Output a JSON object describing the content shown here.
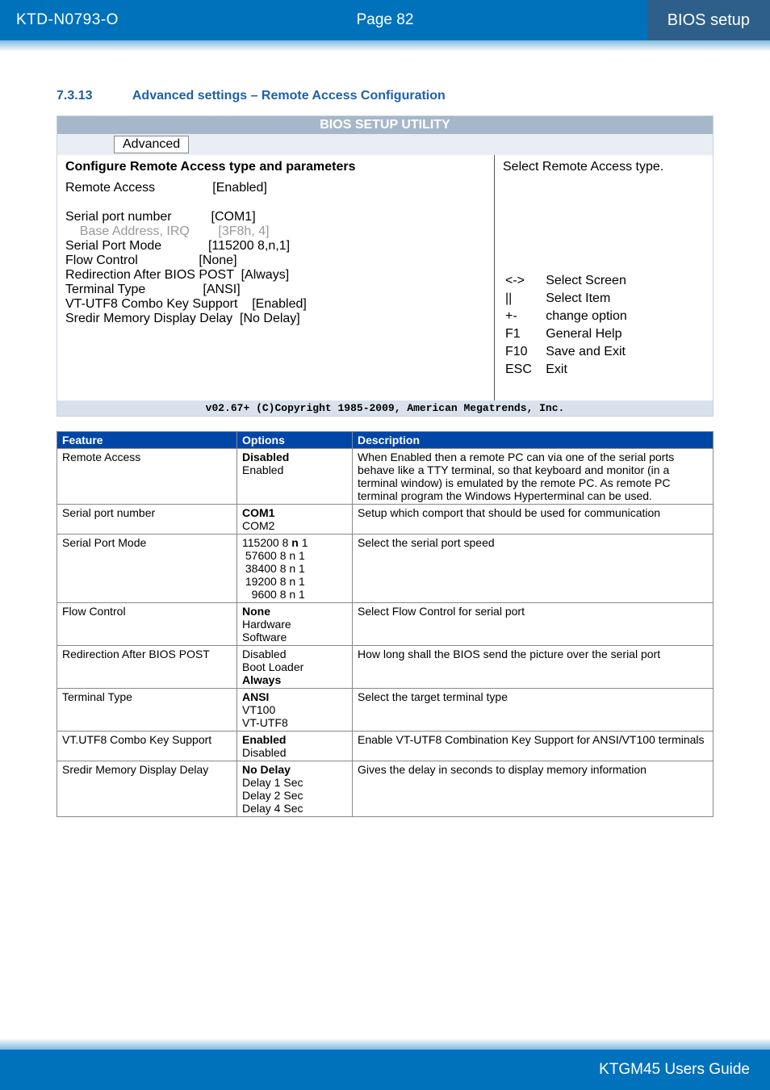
{
  "header": {
    "doc_id": "KTD-N0793-O",
    "page_label": "Page 82",
    "section": "BIOS setup"
  },
  "heading": {
    "number": "7.3.13",
    "title": "Advanced settings – Remote Access Configuration"
  },
  "bios": {
    "title": "BIOS SETUP UTILITY",
    "tab": "Advanced",
    "header_line": "Configure Remote Access type and parameters",
    "items": [
      {
        "label": "Remote Access",
        "value": "[Enabled]",
        "gray": false,
        "indent": 0
      },
      {
        "label": "",
        "value": "",
        "spacer": true
      },
      {
        "label": "Serial port number",
        "value": "[COM1]",
        "gray": false,
        "indent": 0
      },
      {
        "label": "Base Address, IRQ",
        "value": "[3F8h, 4]",
        "gray": true,
        "indent": 1
      },
      {
        "label": "Serial Port Mode",
        "value": "[115200 8,n,1]",
        "gray": false,
        "indent": 0
      },
      {
        "label": "Flow Control",
        "value": "[None]",
        "gray": false,
        "indent": 0
      },
      {
        "label": "Redirection After BIOS POST",
        "value": "[Always]",
        "gray": false,
        "indent": 0
      },
      {
        "label": "Terminal Type",
        "value": "[ANSI]",
        "gray": false,
        "indent": 0
      },
      {
        "label": "VT-UTF8 Combo Key Support",
        "value": "[Enabled]",
        "gray": false,
        "indent": 0
      },
      {
        "label": "Sredir Memory Display Delay",
        "value": "[No Delay]",
        "gray": false,
        "indent": 0
      }
    ],
    "help_top": "Select Remote Access type.",
    "help_keys": [
      {
        "k": "<->",
        "v": "Select Screen"
      },
      {
        "k": "||",
        "v": "Select Item"
      },
      {
        "k": "+-",
        "v": "change option"
      },
      {
        "k": "F1",
        "v": "General Help"
      },
      {
        "k": "F10",
        "v": "Save and Exit"
      },
      {
        "k": "ESC",
        "v": "Exit"
      }
    ],
    "copyright": "v02.67+ (C)Copyright 1985-2009, American Megatrends, Inc."
  },
  "table": {
    "headers": {
      "feature": "Feature",
      "options": "Options",
      "description": "Description"
    },
    "rows": [
      {
        "feature": "Remote Access",
        "options": [
          {
            "t": "Disabled",
            "b": true
          },
          {
            "t": "Enabled"
          }
        ],
        "description": "When Enabled then a remote PC can via one of the serial ports behave like a TTY terminal, so that keyboard and monitor (in a terminal window) is emulated by the remote PC. As remote PC terminal program the Windows Hyperterminal can be used."
      },
      {
        "feature": "Serial port number",
        "options": [
          {
            "t": "COM1",
            "b": true
          },
          {
            "t": "COM2"
          }
        ],
        "description": "Setup which comport that should be used for communication"
      },
      {
        "feature": "Serial Port Mode",
        "options_raw": [
          {
            "pre": "115200 8 ",
            "bold": "n",
            "post": " 1"
          },
          {
            "pre": " 57600 8 n 1"
          },
          {
            "pre": " 38400 8 n 1"
          },
          {
            "pre": " 19200 8 n 1"
          },
          {
            "pre": "   9600 8 n 1"
          }
        ],
        "description": "Select the serial port speed"
      },
      {
        "feature": "Flow Control",
        "options": [
          {
            "t": "None",
            "b": true
          },
          {
            "t": "Hardware"
          },
          {
            "t": "Software"
          }
        ],
        "description": "Select Flow Control for serial port"
      },
      {
        "feature": "Redirection After BIOS POST",
        "options": [
          {
            "t": "Disabled"
          },
          {
            "t": "Boot Loader"
          },
          {
            "t": "Always",
            "b": true
          }
        ],
        "description": "How long shall the BIOS send the picture over the serial port"
      },
      {
        "feature": "Terminal Type",
        "options": [
          {
            "t": "ANSI",
            "b": true
          },
          {
            "t": "VT100"
          },
          {
            "t": "VT-UTF8"
          }
        ],
        "description": "Select the target terminal type"
      },
      {
        "feature": "VT.UTF8 Combo Key Support",
        "options": [
          {
            "t": "Enabled",
            "b": true
          },
          {
            "t": "Disabled"
          }
        ],
        "description": "Enable VT-UTF8 Combination Key Support for ANSI/VT100 terminals"
      },
      {
        "feature": "Sredir Memory Display Delay",
        "options": [
          {
            "t": "No Delay",
            "b": true
          },
          {
            "t": "Delay 1 Sec"
          },
          {
            "t": "Delay 2 Sec"
          },
          {
            "t": "Delay 4 Sec"
          }
        ],
        "description": "Gives the delay in seconds to display memory information"
      }
    ]
  },
  "footer": {
    "guide": "KTGM45 Users Guide"
  }
}
